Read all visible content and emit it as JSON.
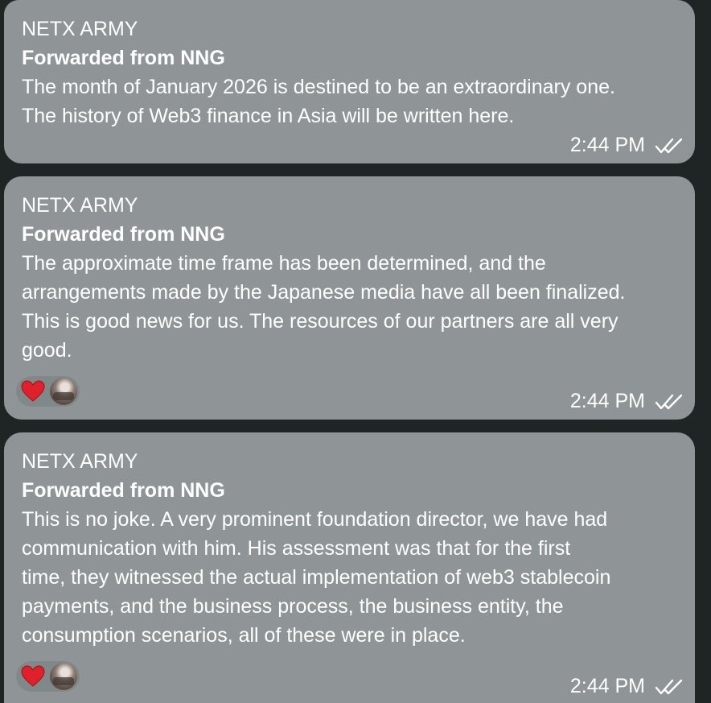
{
  "messages": [
    {
      "sender": "NETX ARMY",
      "forwarded": "Forwarded from NNG",
      "lines": [
        "The month of January 2026 is destined to be an extraordinary one.",
        "The history of Web3 finance in Asia will be written here."
      ],
      "time": "2:44 PM",
      "reactions": []
    },
    {
      "sender": "NETX ARMY",
      "forwarded": "Forwarded from NNG",
      "lines": [
        "The approximate time frame has been determined, and the",
        "arrangements made by the Japanese media have all been finalized.",
        "This is good news for us. The resources of our partners are all very",
        "good."
      ],
      "time": "2:44 PM",
      "reactions": [
        "heart-icon",
        "user-avatar"
      ]
    },
    {
      "sender": "NETX ARMY",
      "forwarded": "Forwarded from NNG",
      "lines": [
        "This is no joke. A very prominent foundation director, we have had",
        "communication with him. His assessment was that for the first",
        "time, they witnessed the actual implementation of web3 stablecoin",
        "payments, and the business process, the business entity, the",
        "consumption scenarios, all of these were in place."
      ],
      "time": "2:44 PM",
      "reactions": [
        "heart-icon",
        "user-avatar"
      ]
    }
  ],
  "colors": {
    "background": "#1f2425",
    "bubble": "#8f9596",
    "reaction_pill": "#80898a",
    "heart": "#e0202a",
    "text": "#ffffff"
  }
}
